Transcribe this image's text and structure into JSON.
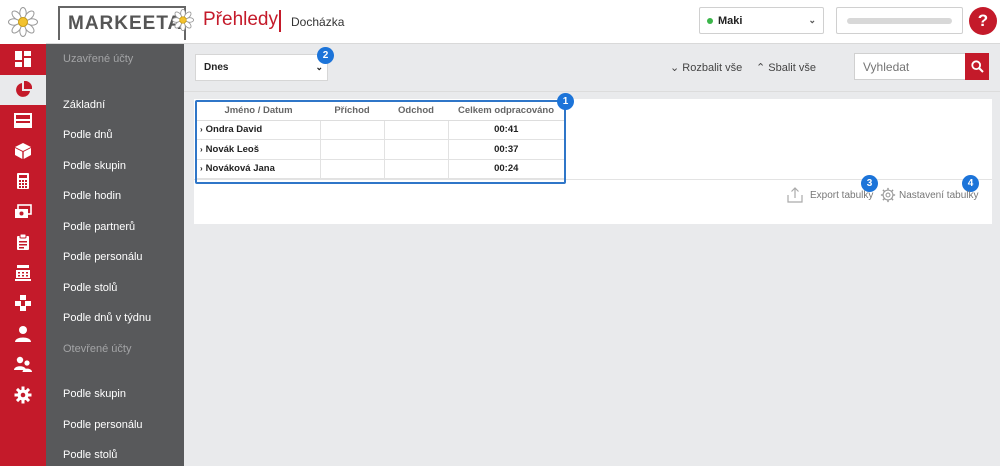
{
  "header": {
    "brand": "MARKEETA",
    "title": "Přehledy",
    "subtitle": "Docházka",
    "user": "Maki",
    "help": "?"
  },
  "rail": {
    "icons": [
      "dashboard-icon",
      "pie-chart-icon",
      "inbox-icon",
      "box-icon",
      "calculator-icon",
      "money-icon",
      "clipboard-icon",
      "cash-register-icon",
      "boxes-icon",
      "user-icon",
      "users-icon",
      "gear-icon"
    ],
    "active_index": 1
  },
  "sidebar": {
    "closed_section": "Uzavřené účty",
    "closed_items": [
      {
        "label": "Základní"
      },
      {
        "label": "Podle dnů"
      },
      {
        "label": "Podle skupin"
      },
      {
        "label": "Podle hodin"
      },
      {
        "label": "Podle partnerů"
      },
      {
        "label": "Podle personálu"
      },
      {
        "label": "Podle stolů"
      },
      {
        "label": "Podle dnů v týdnu"
      }
    ],
    "open_section": "Otevřené účty",
    "open_items": [
      {
        "label": "Podle skupin"
      },
      {
        "label": "Podle personálu"
      },
      {
        "label": "Podle stolů"
      }
    ]
  },
  "toolbar": {
    "period": "Dnes",
    "expand_all": "Rozbalit vše",
    "collapse_all": "Sbalit vše",
    "search_placeholder": "Vyhledat"
  },
  "table": {
    "headers": [
      "Jméno / Datum",
      "Příchod",
      "Odchod",
      "Celkem odpracováno"
    ],
    "rows": [
      {
        "name": "Ondra David",
        "arrival": "",
        "departure": "",
        "total": "00:41"
      },
      {
        "name": "Novák Leoš",
        "arrival": "",
        "departure": "",
        "total": "00:37"
      },
      {
        "name": "Nováková Jana",
        "arrival": "",
        "departure": "",
        "total": "00:24"
      }
    ]
  },
  "footer": {
    "export": "Export tabulky",
    "settings": "Nastavení tabulky"
  },
  "badges": [
    "1",
    "2",
    "3",
    "4"
  ],
  "colors": {
    "brand_red": "#c41a2a",
    "sidebar_gray": "#58595b",
    "badge_blue": "#1c74d9",
    "online_green": "#3bb54a"
  }
}
